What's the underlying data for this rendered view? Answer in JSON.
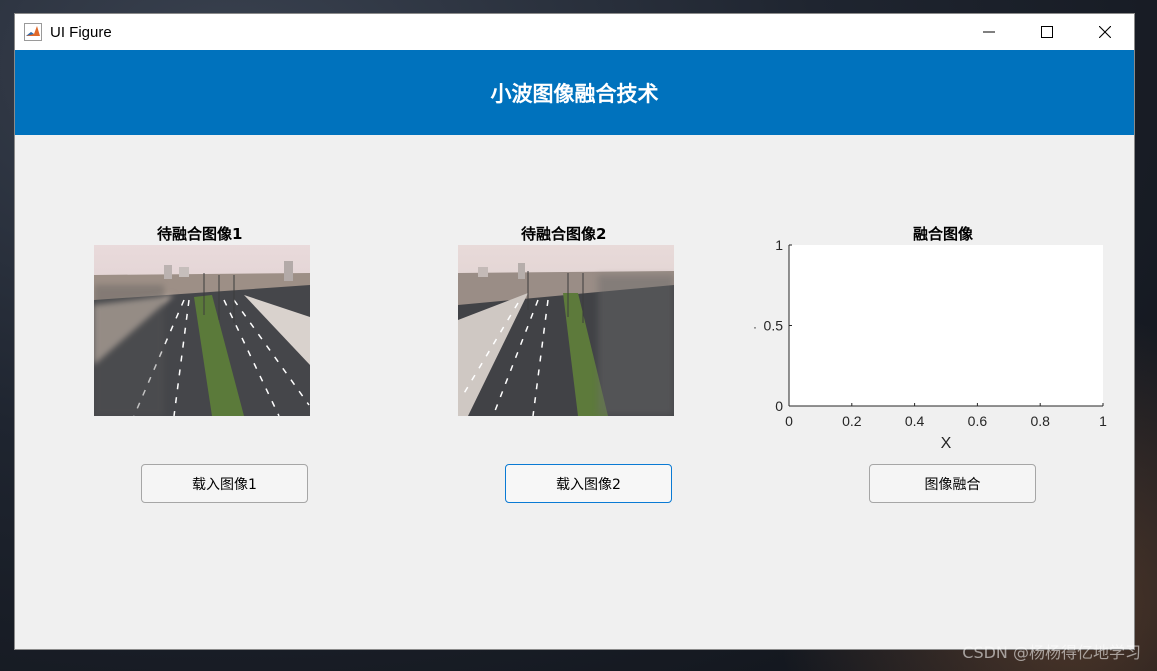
{
  "window": {
    "title": "UI Figure"
  },
  "header": {
    "title": "小波图像融合技术"
  },
  "panels": [
    {
      "title": "待融合图像1",
      "button_label": "载入图像1"
    },
    {
      "title": "待融合图像2",
      "button_label": "载入图像2"
    },
    {
      "title": "融合图像",
      "button_label": "图像融合"
    }
  ],
  "axes": {
    "xlabel": "X",
    "xticks": [
      "0",
      "0.2",
      "0.4",
      "0.6",
      "0.8",
      "1"
    ],
    "yticks": [
      "0",
      "0.5",
      "1"
    ],
    "xlim": [
      0,
      1
    ],
    "ylim": [
      0,
      1
    ],
    "ylabel_glyph": "·"
  },
  "watermark": "CSDN @杨杨得亿地学习",
  "colors": {
    "header": "#0072bd",
    "window_bg": "#f0f0f0",
    "focus_border": "#0a7ad4"
  }
}
